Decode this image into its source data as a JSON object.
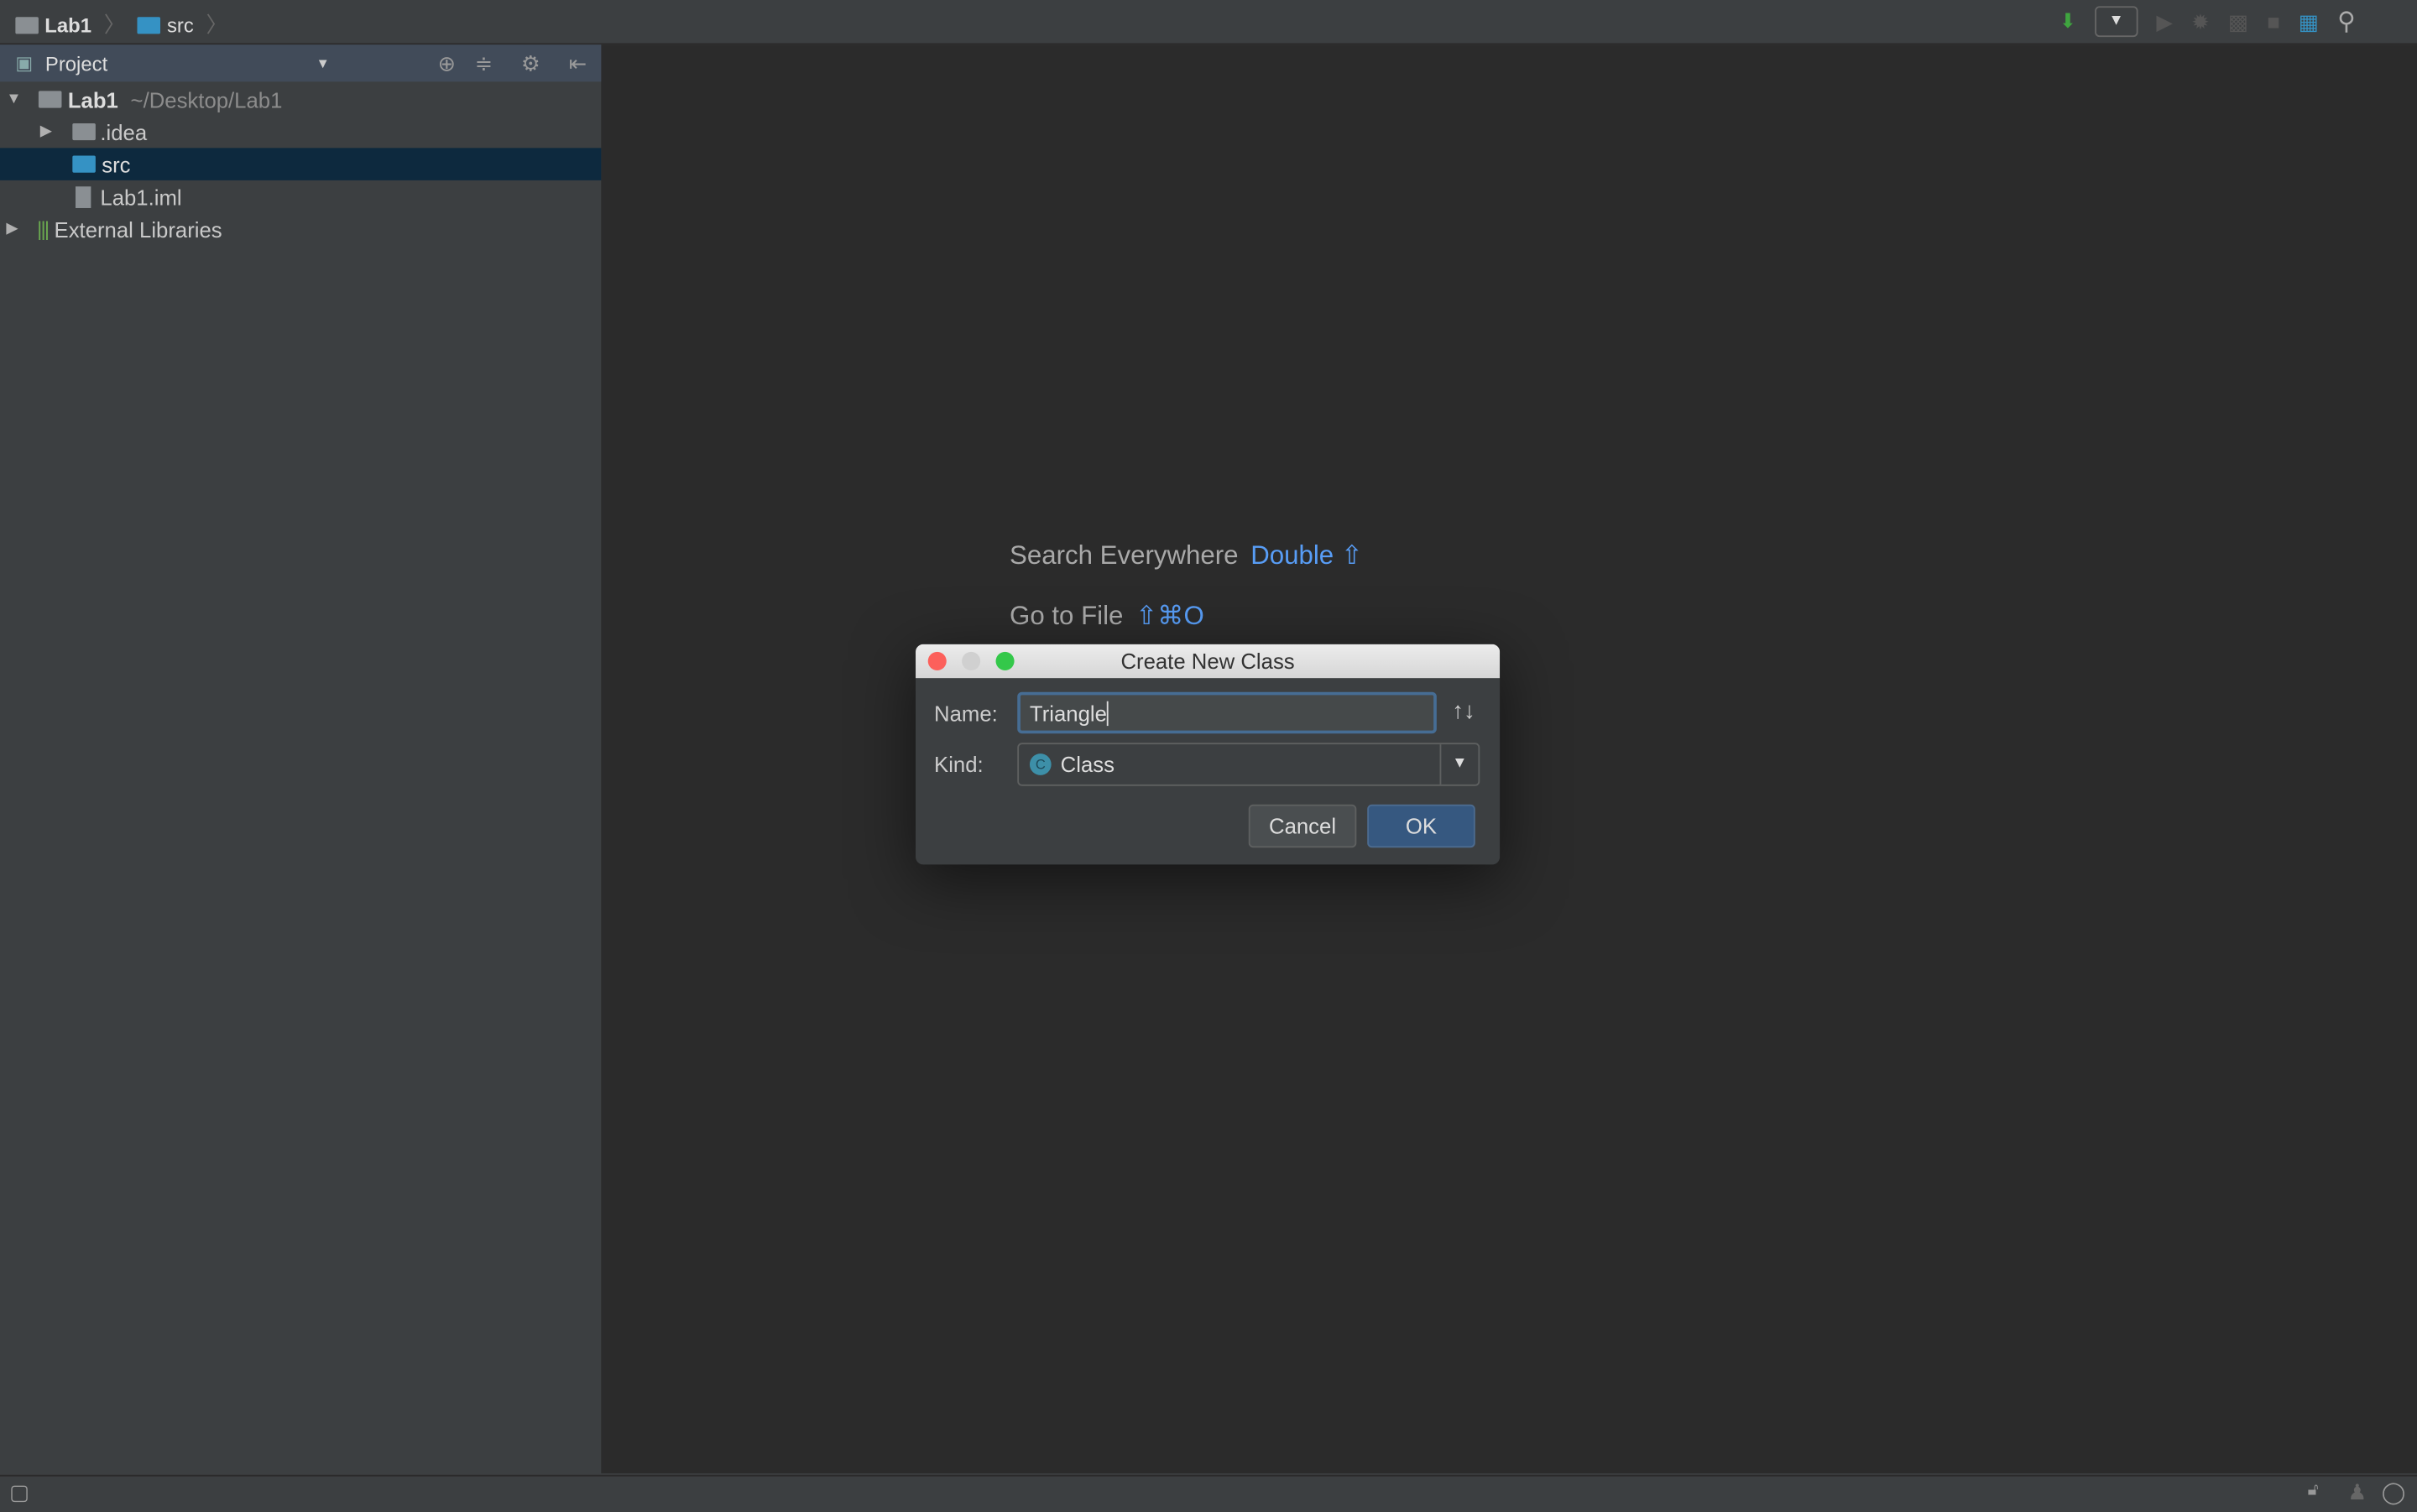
{
  "breadcrumb": [
    "Lab1",
    "src"
  ],
  "project_panel": {
    "title": "Project"
  },
  "tree": [
    {
      "label": "Lab1",
      "path": "~/Desktop/Lab1"
    },
    {
      "label": ".idea"
    },
    {
      "label": "src"
    },
    {
      "label": "Lab1.iml"
    },
    {
      "label": "External Libraries"
    }
  ],
  "editor_hints": [
    {
      "label": "Search Everywhere",
      "shortcut": "Double ⇧"
    },
    {
      "label": "Go to File",
      "shortcut": "⇧⌘O"
    }
  ],
  "dialog": {
    "title": "Create New Class",
    "name_label": "Name:",
    "name_value": "Triangle",
    "kind_label": "Kind:",
    "kind_value": "Class",
    "kind_icon_letter": "C",
    "cancel": "Cancel",
    "ok": "OK"
  },
  "colors": {
    "accent": "#589df6",
    "selection": "#0d293e",
    "folder": "#3592c4"
  }
}
